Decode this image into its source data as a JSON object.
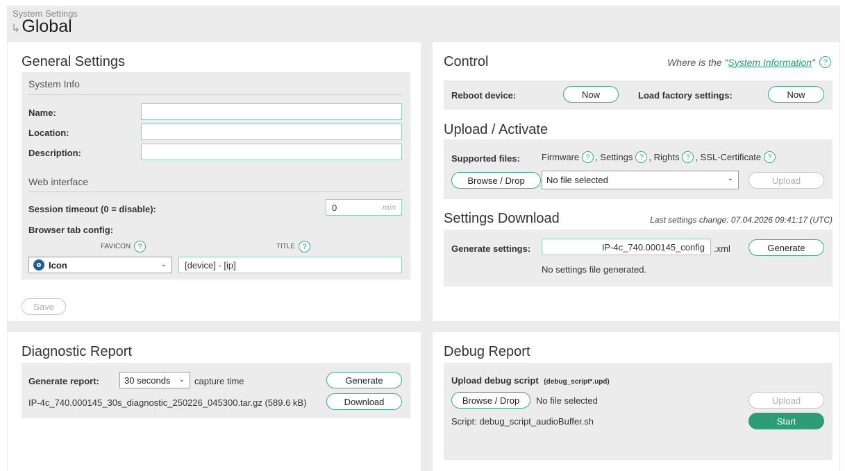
{
  "breadcrumb": {
    "parent": "System Settings",
    "current": "Global"
  },
  "general": {
    "title": "General Settings",
    "system_info": {
      "title": "System Info",
      "name_label": "Name:",
      "name_value": "",
      "location_label": "Location:",
      "location_value": "",
      "description_label": "Description:",
      "description_value": ""
    },
    "web": {
      "title": "Web interface",
      "timeout_label": "Session timeout (0 = disable):",
      "timeout_value": "0",
      "timeout_unit": "min",
      "browser_tab_label": "Browser tab config:",
      "favicon_header": "FAVICON",
      "title_header": "TITLE",
      "favicon_value": "Icon",
      "title_value": "[device] - [ip]"
    },
    "save_label": "Save"
  },
  "control": {
    "title": "Control",
    "sysinfo_prefix": "Where is the \"",
    "sysinfo_link": "System Information",
    "sysinfo_suffix": "\"",
    "reboot_label": "Reboot device:",
    "reboot_button": "Now",
    "factory_label": "Load factory settings:",
    "factory_button": "Now"
  },
  "upload": {
    "title": "Upload / Activate",
    "supported_label": "Supported files:",
    "firmware": "Firmware",
    "settings": ", Settings",
    "rights": ", Rights",
    "ssl": ", SSL-Certificate",
    "browse_button": "Browse / Drop",
    "file_value": "No file selected",
    "upload_button": "Upload"
  },
  "settings_download": {
    "title": "Settings Download",
    "last_change": "Last settings change: 07.04.2026 09:41:17 (UTC)",
    "generate_label": "Generate settings:",
    "filename_value": "IP-4c_740.000145_config",
    "extension": ".xml",
    "generate_button": "Generate",
    "status": "No settings file generated."
  },
  "diagnostic": {
    "title": "Diagnostic Report",
    "generate_label": "Generate report:",
    "capture_value": "30 seconds",
    "capture_suffix": "capture time",
    "generate_button": "Generate",
    "file_info": "IP-4c_740.000145_30s_diagnostic_250226_045300.tar.gz (589.6 kB)",
    "download_button": "Download"
  },
  "debug": {
    "title": "Debug Report",
    "upload_label": "Upload debug script",
    "upload_hint": "(debug_script*.upd)",
    "browse_button": "Browse / Drop",
    "file_value": "No file selected",
    "upload_button": "Upload",
    "script_text": "Script: debug_script_audioBuffer.sh",
    "start_button": "Start"
  },
  "icons": {
    "help_glyph": "?",
    "chevron_glyph": "⌄",
    "arrow_glyph": "↪"
  },
  "colors": {
    "accent": "#3aaa86",
    "start": "#2e9c76"
  }
}
